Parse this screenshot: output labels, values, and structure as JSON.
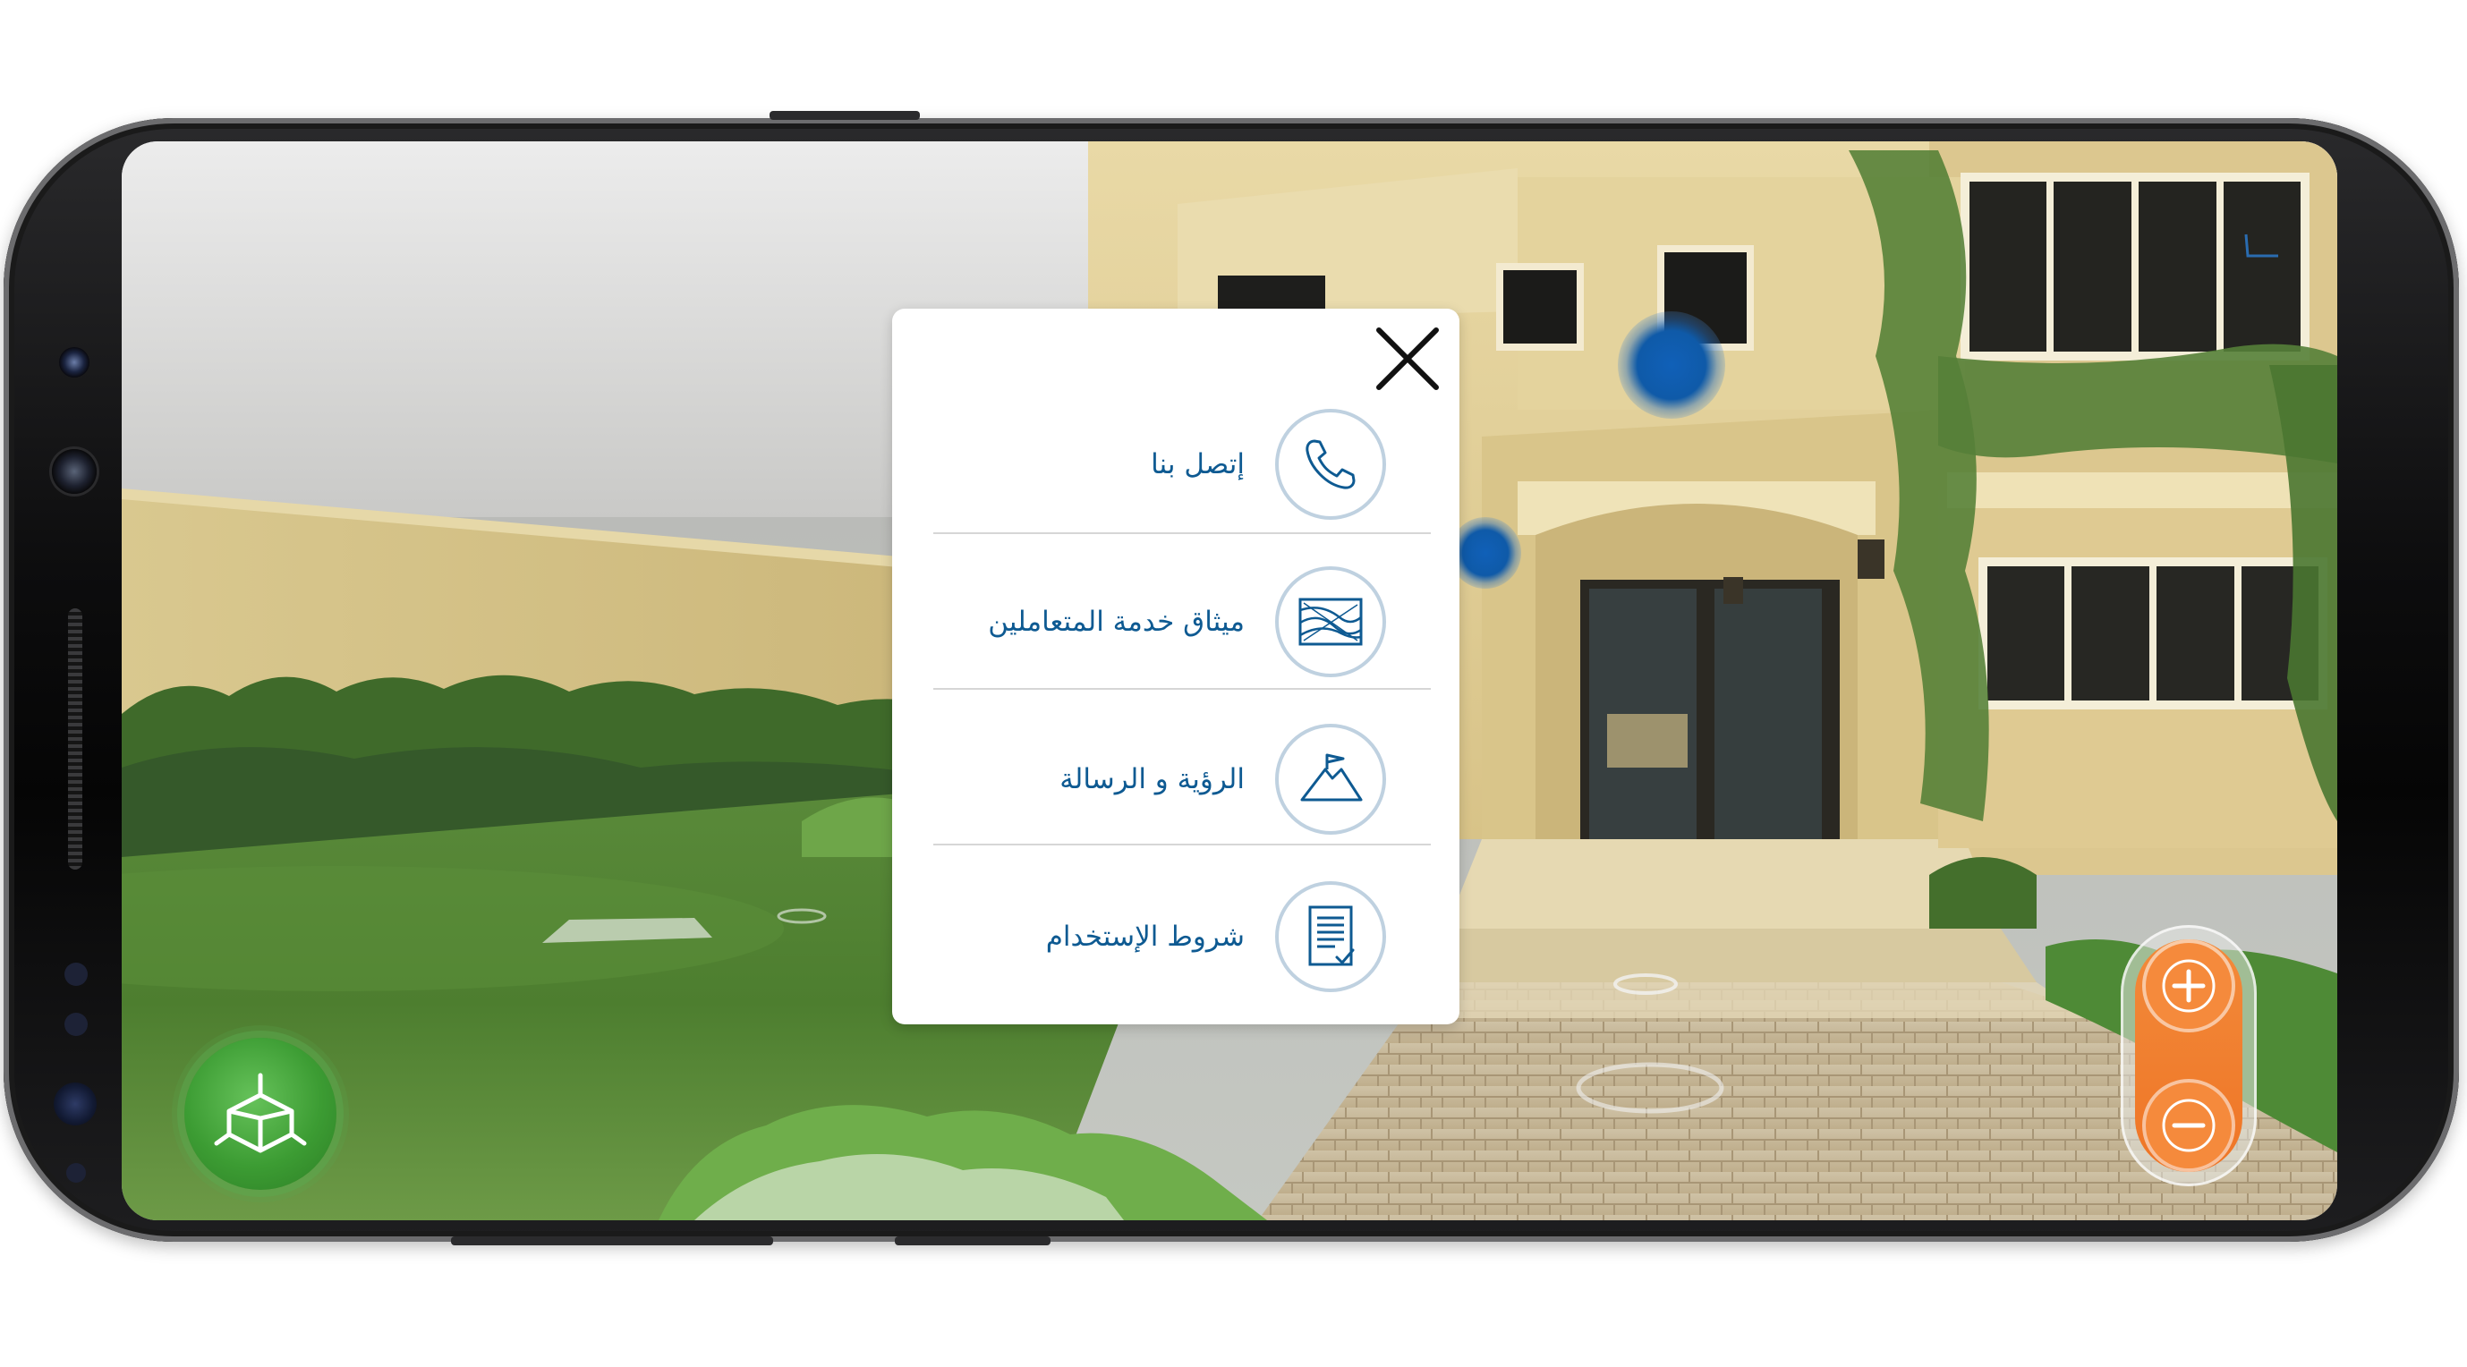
{
  "menu": {
    "items": [
      {
        "label": "إتصل بنا",
        "icon": "phone-icon"
      },
      {
        "label": "ميثاق خدمة المتعاملين",
        "icon": "customer-charter-icon"
      },
      {
        "label": "الرؤية و الرسالة",
        "icon": "vision-mission-icon"
      },
      {
        "label": "شروط الإستخدام",
        "icon": "terms-document-icon"
      }
    ],
    "close_icon": "close-icon"
  },
  "controls": {
    "threed_view_icon": "cube-3d-icon",
    "zoom_in_icon": "plus-icon",
    "zoom_out_icon": "minus-icon"
  },
  "colors": {
    "accent_blue": "#0e5a92",
    "icon_ring": "#bfd1e0",
    "zoom_orange": "#f28a3a",
    "threed_green": "#3c9c33",
    "hotspot_blue": "#0f5aa8"
  }
}
